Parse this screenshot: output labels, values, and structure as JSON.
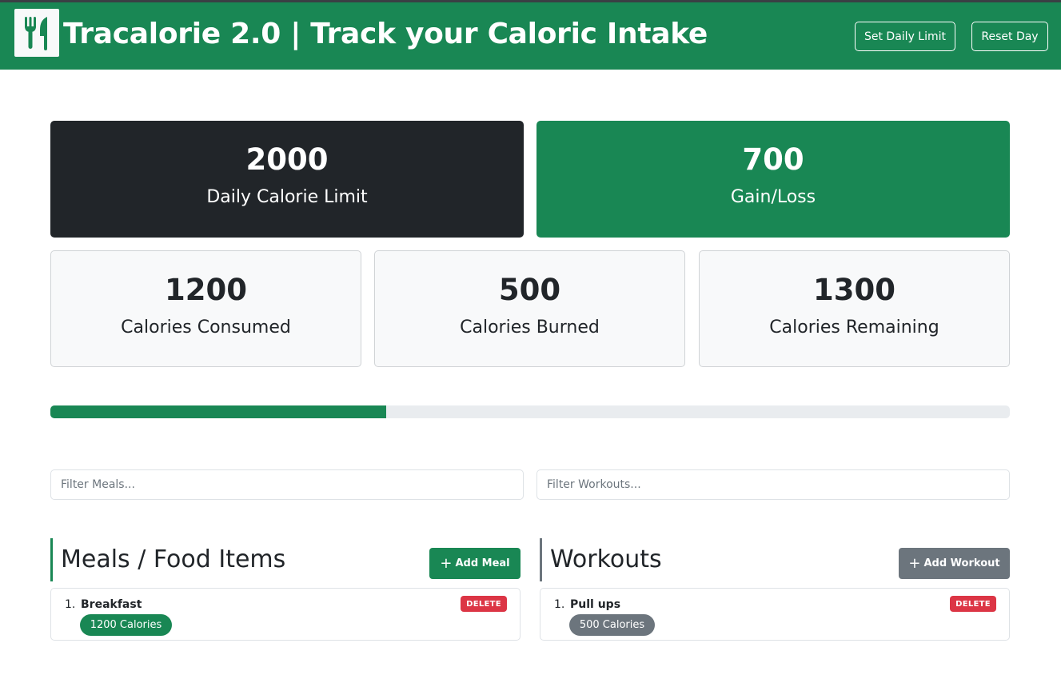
{
  "header": {
    "title": "Tracalorie 2.0 | Track your Caloric Intake",
    "logo_icon": "utensils-icon",
    "set_limit_label": "Set Daily Limit",
    "reset_label": "Reset Day"
  },
  "stats": {
    "limit": {
      "value": "2000",
      "label": "Daily Calorie Limit"
    },
    "gain_loss": {
      "value": "700",
      "label": "Gain/Loss"
    },
    "consumed": {
      "value": "1200",
      "label": "Calories Consumed"
    },
    "burned": {
      "value": "500",
      "label": "Calories Burned"
    },
    "remaining": {
      "value": "1300",
      "label": "Calories Remaining"
    }
  },
  "progress": {
    "percent": 35
  },
  "filters": {
    "meals_placeholder": "Filter Meals...",
    "workouts_placeholder": "Filter Workouts..."
  },
  "meals": {
    "title": "Meals / Food Items",
    "add_label": "Add Meal",
    "items": [
      {
        "index": "1.",
        "name": "Breakfast",
        "calories": "1200 Calories",
        "delete_label": "DELETE"
      }
    ]
  },
  "workouts": {
    "title": "Workouts",
    "add_label": "Add Workout",
    "items": [
      {
        "index": "1.",
        "name": "Pull ups",
        "calories": "500 Calories",
        "delete_label": "DELETE"
      }
    ]
  },
  "colors": {
    "primary": "#198754",
    "dark": "#212529",
    "secondary": "#6c757d",
    "danger": "#dc3545",
    "light": "#f8f9fa"
  }
}
